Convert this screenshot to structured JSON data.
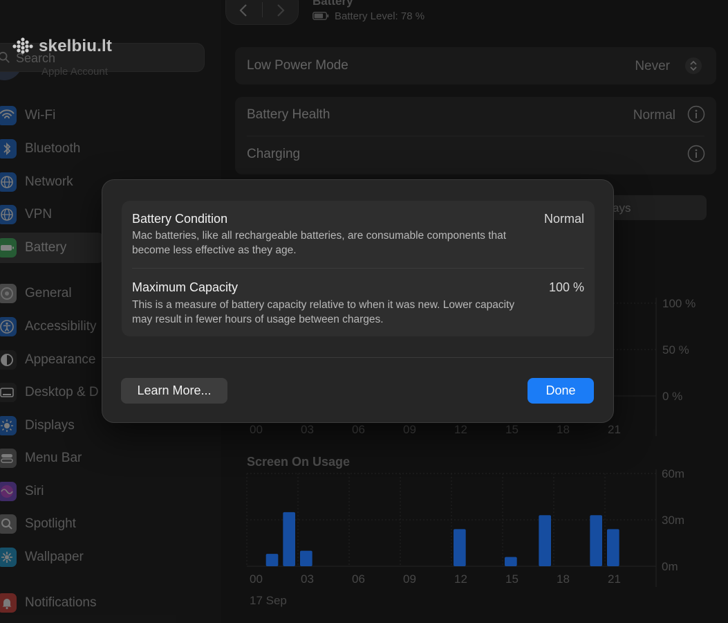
{
  "watermark": {
    "text": "skelbiu.lt"
  },
  "window": {
    "title": "Battery",
    "battery_level": "Battery Level: 78 %"
  },
  "sidebar": {
    "search_placeholder": "Search",
    "account_sub": "Apple Account",
    "items": [
      {
        "label": "Wi-Fi",
        "icon": "wifi-icon",
        "color": "#1e6fd8"
      },
      {
        "label": "Bluetooth",
        "icon": "bluetooth-icon",
        "color": "#1e6fd8"
      },
      {
        "label": "Network",
        "icon": "globe-icon",
        "color": "#1e6fd8"
      },
      {
        "label": "VPN",
        "icon": "globe-icon",
        "color": "#1e6fd8"
      },
      {
        "label": "Battery",
        "icon": "battery-icon",
        "color": "#34a853"
      },
      {
        "label": "General",
        "icon": "gear-icon",
        "color": "#8e8e8e"
      },
      {
        "label": "Accessibility",
        "icon": "accessibility-icon",
        "color": "#1e6fd8"
      },
      {
        "label": "Appearance",
        "icon": "appearance-icon",
        "color": "#2b2b2b"
      },
      {
        "label": "Desktop & D",
        "icon": "desktop-icon",
        "color": "#2b2b2b"
      },
      {
        "label": "Displays",
        "icon": "sun-icon",
        "color": "#1e6fd8"
      },
      {
        "label": "Menu Bar",
        "icon": "menubar-icon",
        "color": "#6b6b6b"
      },
      {
        "label": "Siri",
        "icon": "siri-icon",
        "color": "#7a4bd1"
      },
      {
        "label": "Spotlight",
        "icon": "magnifier-icon",
        "color": "#7d7d7d"
      },
      {
        "label": "Wallpaper",
        "icon": "wallpaper-icon",
        "color": "#1f9fd6"
      },
      {
        "label": "Notifications",
        "icon": "bell-icon",
        "color": "#d9423c"
      }
    ]
  },
  "settings": {
    "low_power_label": "Low Power Mode",
    "low_power_value": "Never",
    "battery_health_label": "Battery Health",
    "battery_health_value": "Normal",
    "charging_label": "Charging",
    "segment_visible": "ays"
  },
  "level_chart": {
    "y_ticks": [
      "100 %",
      "50 %",
      "0 %"
    ],
    "x_ticks": [
      "00",
      "03",
      "06",
      "09",
      "12",
      "15",
      "18",
      "21"
    ]
  },
  "chart_data": {
    "type": "bar",
    "title": "Screen On Usage",
    "x": [
      "00",
      "01",
      "02",
      "03",
      "04",
      "05",
      "06",
      "07",
      "08",
      "09",
      "10",
      "11",
      "12",
      "13",
      "14",
      "15",
      "16",
      "17",
      "18",
      "19",
      "20",
      "21",
      "22",
      "23"
    ],
    "values": [
      0,
      8,
      35,
      10,
      0,
      0,
      0,
      0,
      0,
      0,
      0,
      0,
      24,
      0,
      0,
      6,
      0,
      33,
      0,
      0,
      33,
      24,
      0,
      0
    ],
    "x_ticks": [
      "00",
      "03",
      "06",
      "09",
      "12",
      "15",
      "18",
      "21"
    ],
    "y_ticks": [
      "60m",
      "30m",
      "0m"
    ],
    "ylim": [
      0,
      60
    ],
    "date": "17 Sep",
    "bar_color": "#1c5fc4",
    "grid": true
  },
  "modal": {
    "condition_title": "Battery Condition",
    "condition_value": "Normal",
    "condition_desc": "Mac batteries, like all rechargeable batteries, are consumable components that become less effective as they age.",
    "capacity_title": "Maximum Capacity",
    "capacity_value": "100 %",
    "capacity_desc": "This is a measure of battery capacity relative to when it was new. Lower capacity may result in fewer hours of usage between charges.",
    "learn_more": "Learn More...",
    "done": "Done",
    "done_color": "#1b7cf6"
  }
}
